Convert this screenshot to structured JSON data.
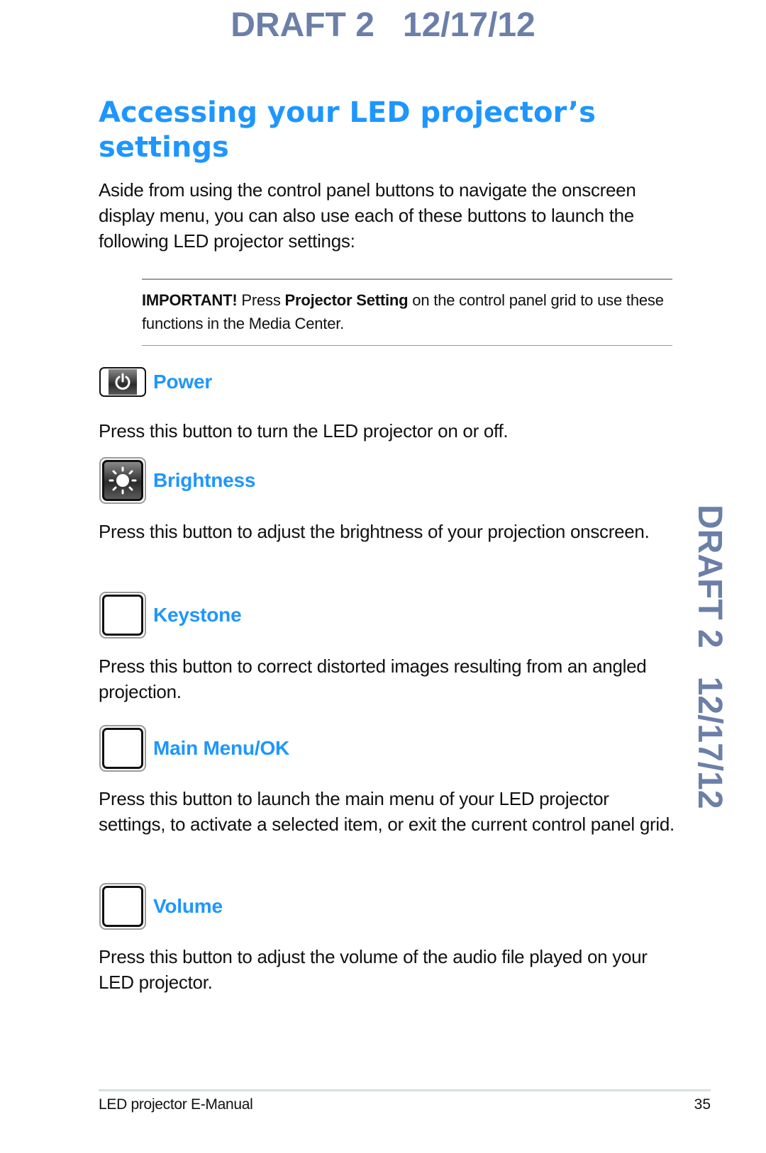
{
  "watermark": {
    "top": "DRAFT 2   12/17/12",
    "side": "DRAFT 2   12/17/12",
    "color": "#6b7fa8"
  },
  "page": {
    "title": "Accessing your LED projector’s settings",
    "intro": "Aside from using the control panel buttons to navigate the onscreen display menu, you can also use each of these buttons to launch the following LED projector settings:",
    "heading_color": "#1e96ff"
  },
  "note": {
    "lead": "IMPORTANT!",
    "text1": " Press ",
    "emphasis": "Projector Setting",
    "text2": " on the control panel grid to use these functions in the Media Center."
  },
  "sections": [
    {
      "label": "Power",
      "icon": "power-icon",
      "description": "Press this button to turn the LED projector on or off."
    },
    {
      "label": "Brightness",
      "icon": "sun-icon",
      "description": "Press this button to adjust the brightness of your projection onscreen."
    },
    {
      "label": "Keystone",
      "icon": "blank-key-icon",
      "description": "Press this button to correct distorted images resulting from an angled projection."
    },
    {
      "label": "Main Menu/OK",
      "icon": "blank-key-icon",
      "description": "Press this button to launch the main menu of your LED projector settings, to activate a selected item, or exit the current control panel grid."
    },
    {
      "label": "Volume",
      "icon": "blank-key-icon",
      "description": "Press this button to adjust the volume of the audio file played on your LED projector."
    }
  ],
  "footer": {
    "manual_name": "LED projector E-Manual",
    "page_number": "35"
  }
}
